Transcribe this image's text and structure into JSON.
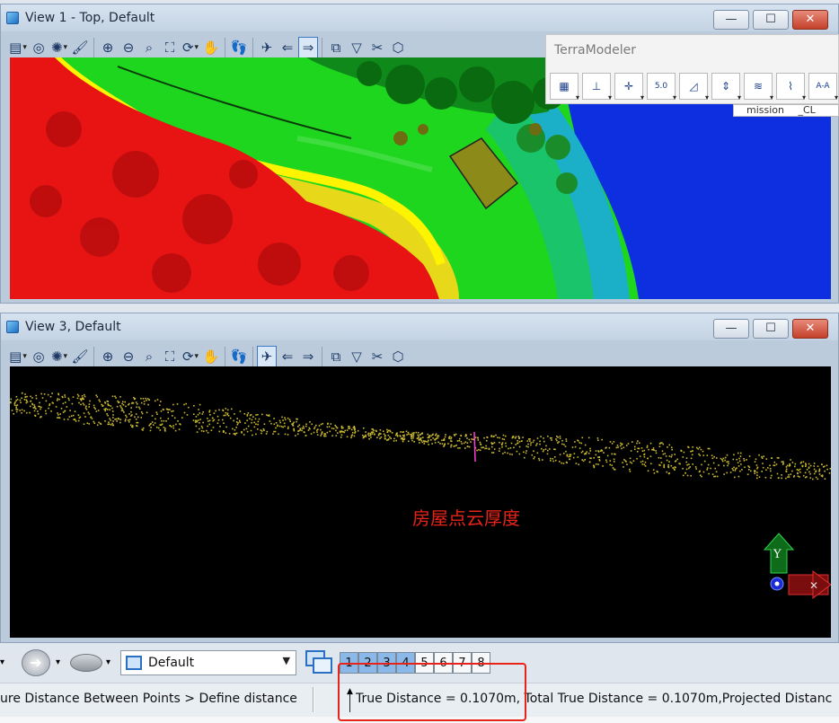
{
  "view1": {
    "title": "View 1 - Top, Default"
  },
  "view3": {
    "title": "View 3, Default",
    "annotation": "房屋点云厚度",
    "axis_y": "Y"
  },
  "window_buttons": {
    "minimize": "—",
    "maximize": "☐",
    "close": "✕"
  },
  "terramodeler": {
    "title": "TerraModeler",
    "behind_label_1": "mission",
    "behind_label_2": "_CL",
    "tools": [
      {
        "icon": "building-grid-icon",
        "glyph": "▦"
      },
      {
        "icon": "section-profile-icon",
        "glyph": "⊥"
      },
      {
        "icon": "add-point-icon",
        "glyph": "✛"
      },
      {
        "icon": "contour-label-icon",
        "glyph": "5.0"
      },
      {
        "icon": "triangle-edit-icon",
        "glyph": "◿"
      },
      {
        "icon": "height-arrows-icon",
        "glyph": "⇕"
      },
      {
        "icon": "contours-icon",
        "glyph": "≋"
      },
      {
        "icon": "breakline-icon",
        "glyph": "⌇"
      },
      {
        "icon": "section-ab-icon",
        "glyph": "A-A"
      }
    ]
  },
  "view_tools": [
    {
      "icon": "view-attributes-icon",
      "glyph": "▤",
      "dd": true
    },
    {
      "icon": "display-style-icon",
      "glyph": "◎",
      "dd": false
    },
    {
      "icon": "lighting-icon",
      "glyph": "✺",
      "dd": true
    },
    {
      "icon": "brush-update-icon",
      "glyph": "🖌",
      "dd": false
    },
    {
      "icon": "zoom-in-icon",
      "glyph": "⊕",
      "dd": false
    },
    {
      "icon": "zoom-out-icon",
      "glyph": "⊖",
      "dd": false
    },
    {
      "icon": "window-area-icon",
      "glyph": "⌕",
      "dd": false
    },
    {
      "icon": "fit-view-icon",
      "glyph": "⛶",
      "dd": false
    },
    {
      "icon": "rotate-view-icon",
      "glyph": "⟳",
      "dd": true
    },
    {
      "icon": "pan-hand-icon",
      "glyph": "✋",
      "dd": false
    },
    {
      "icon": "walk-footprints-icon",
      "glyph": "👣",
      "dd": false
    },
    {
      "icon": "fly-plane-icon",
      "glyph": "✈",
      "dd": false
    },
    {
      "icon": "view-previous-icon",
      "glyph": "⇐",
      "dd": false
    },
    {
      "icon": "view-next-icon",
      "glyph": "⇒",
      "dd": false
    },
    {
      "icon": "copy-view-icon",
      "glyph": "⧉",
      "dd": false
    },
    {
      "icon": "camera-cone-icon",
      "glyph": "▽",
      "dd": false
    },
    {
      "icon": "clip-volume-icon",
      "glyph": "✂",
      "dd": false
    },
    {
      "icon": "clip-cube-icon",
      "glyph": "⬡",
      "dd": false
    }
  ],
  "bottom": {
    "model_combo": "Default",
    "view_numbers": [
      "1",
      "2",
      "3",
      "4",
      "5",
      "6",
      "7",
      "8"
    ],
    "view_numbers_on": [
      true,
      true,
      true,
      true,
      false,
      false,
      false,
      false
    ]
  },
  "status": {
    "prompt": "ure Distance Between Points > Define distance",
    "result": "True Distance = 0.1070m, Total True Distance = 0.1070m,Projected Distanc"
  },
  "colors": {
    "highlight_box": "#e8231a",
    "annotation": "#e8231a",
    "point_yellow": "#c8b830"
  }
}
